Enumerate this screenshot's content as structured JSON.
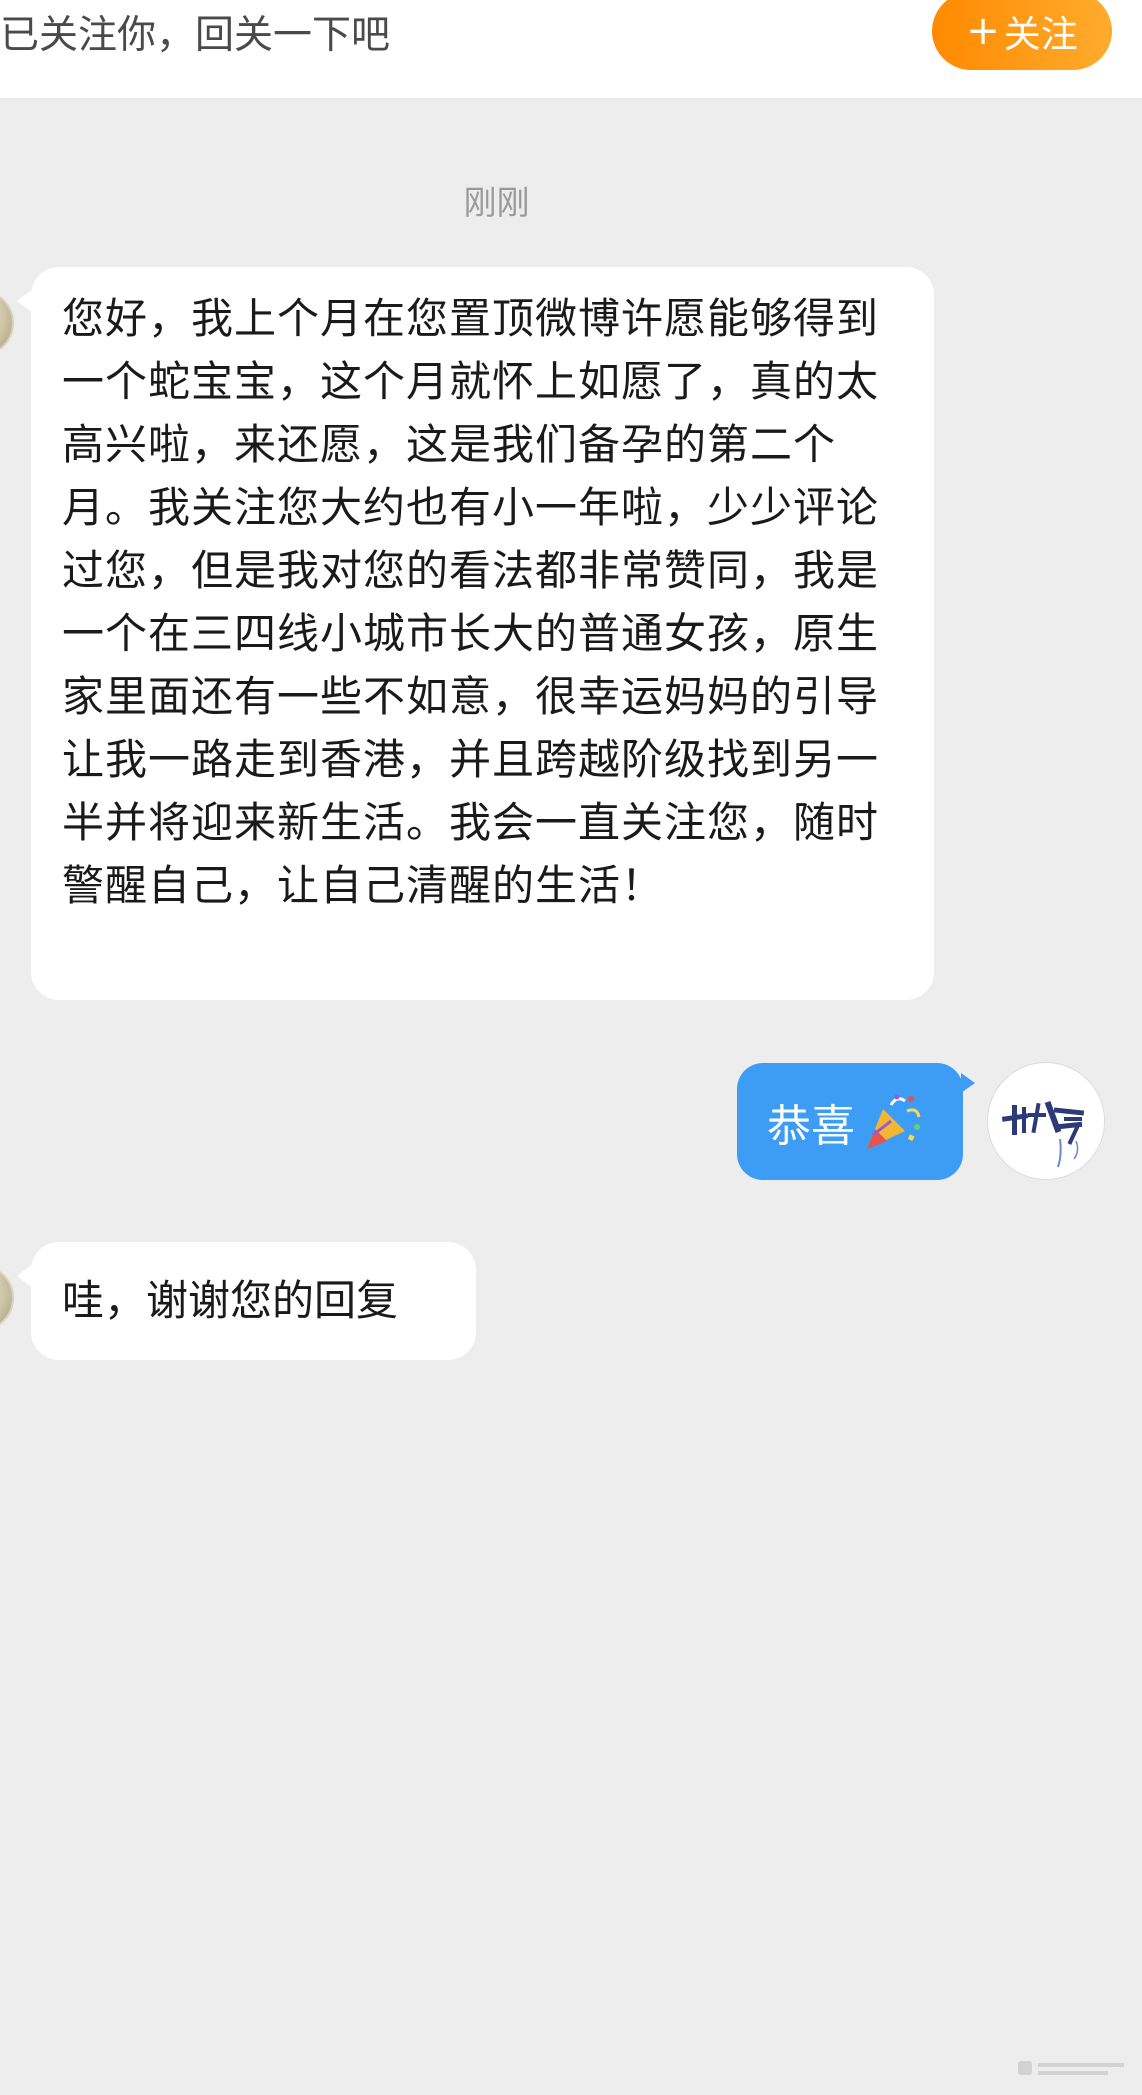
{
  "header": {
    "follow_hint": "已关注你，回关一下吧",
    "follow_button": {
      "icon": "plus-icon",
      "label": "关注"
    }
  },
  "timestamp": "刚刚",
  "messages": [
    {
      "side": "left",
      "text": "您好，我上个月在您置顶微博许愿能够得到一个蛇宝宝，这个月就怀上如愿了，真的太高兴啦，来还愿，这是我们备孕的第二个月。我关注您大约也有小一年啦，少少评论过您，但是我对您的看法都非常赞同，我是一个在三四线小城市长大的普通女孩，原生家里面还有一些不如意，很幸运妈妈的引导让我一路走到香港，并且跨越阶级找到另一半并将迎来新生活。我会一直关注您，随时警醒自己，让自己清醒的生活！"
    },
    {
      "side": "right",
      "text": "恭喜",
      "emoji": "party-popper-icon"
    },
    {
      "side": "left",
      "text": "哇，谢谢您的回复"
    }
  ],
  "colors": {
    "background": "#ededed",
    "sent_bubble": "#3d9df5",
    "received_bubble": "#ffffff",
    "follow_button": "#ff9500"
  }
}
